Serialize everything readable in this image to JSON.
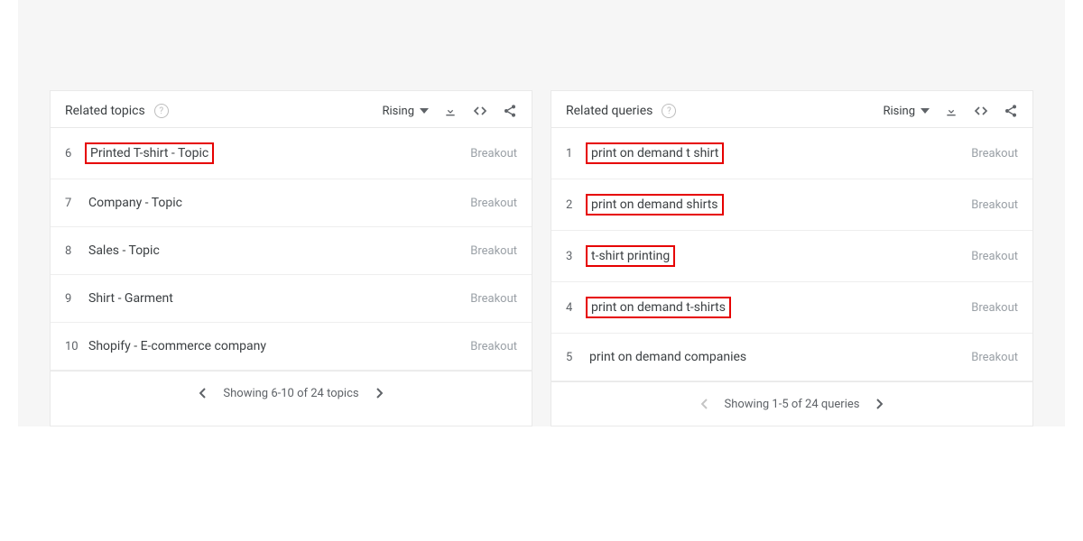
{
  "cards": [
    {
      "title": "Related topics",
      "dropdown": "Rising",
      "rows": [
        {
          "num": "6",
          "text": "Printed T-shirt - Topic",
          "value": "Breakout",
          "highlighted": true
        },
        {
          "num": "7",
          "text": "Company - Topic",
          "value": "Breakout",
          "highlighted": false
        },
        {
          "num": "8",
          "text": "Sales - Topic",
          "value": "Breakout",
          "highlighted": false
        },
        {
          "num": "9",
          "text": "Shirt - Garment",
          "value": "Breakout",
          "highlighted": false
        },
        {
          "num": "10",
          "text": "Shopify - E-commerce company",
          "value": "Breakout",
          "highlighted": false
        }
      ],
      "footer_text": "Showing 6-10 of 24 topics",
      "prev_enabled": true,
      "next_enabled": true
    },
    {
      "title": "Related queries",
      "dropdown": "Rising",
      "rows": [
        {
          "num": "1",
          "text": "print on demand t shirt",
          "value": "Breakout",
          "highlighted": true
        },
        {
          "num": "2",
          "text": "print on demand shirts",
          "value": "Breakout",
          "highlighted": true
        },
        {
          "num": "3",
          "text": "t-shirt printing",
          "value": "Breakout",
          "highlighted": true
        },
        {
          "num": "4",
          "text": "print on demand t-shirts",
          "value": "Breakout",
          "highlighted": true
        },
        {
          "num": "5",
          "text": "print on demand companies",
          "value": "Breakout",
          "highlighted": false
        }
      ],
      "footer_text": "Showing 1-5 of 24 queries",
      "prev_enabled": false,
      "next_enabled": true
    }
  ]
}
